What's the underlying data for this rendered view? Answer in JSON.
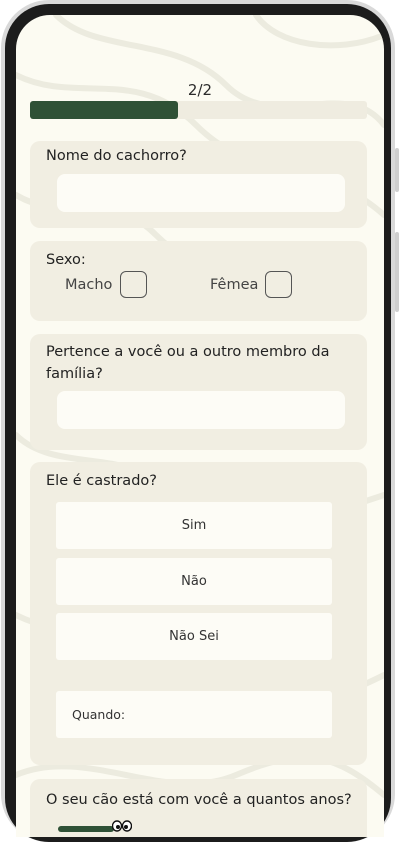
{
  "progress": {
    "label": "2/2",
    "fraction": 0.44
  },
  "q_dog_name": {
    "label": "Nome do cachorro?",
    "value": ""
  },
  "q_sex": {
    "label": "Sexo:",
    "options": [
      "Macho",
      "Fêmea"
    ]
  },
  "q_belongs": {
    "label": "Pertence a você ou a outro membro da família?",
    "value": ""
  },
  "q_castrated": {
    "label": "Ele é castrado?",
    "options": [
      "Sim",
      "Não",
      "Não Sei"
    ],
    "when_label": "Quando:"
  },
  "q_years": {
    "label": "O seu cão está com você a quantos anos?"
  },
  "colors": {
    "accent": "#2f5136",
    "card": "#f1eee2",
    "background": "#fcfbf2"
  }
}
